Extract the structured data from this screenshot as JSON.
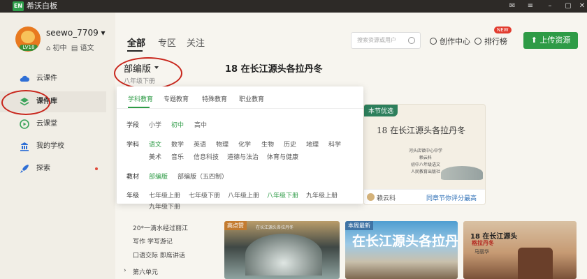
{
  "app": {
    "logo": "EN",
    "title": "希沃白板"
  },
  "user": {
    "name": "seewo_7709",
    "school_level": "初中",
    "subject": "语文",
    "level_badge": "LV18"
  },
  "sidebar": {
    "items": [
      {
        "label": "云课件",
        "icon": "cloud-icon"
      },
      {
        "label": "课件库",
        "icon": "library-icon"
      },
      {
        "label": "云课堂",
        "icon": "play-icon"
      },
      {
        "label": "我的学校",
        "icon": "school-icon"
      },
      {
        "label": "探索",
        "icon": "rocket-icon"
      }
    ]
  },
  "tabs": [
    "全部",
    "专区",
    "关注"
  ],
  "search": {
    "placeholder": "搜索资源或用户"
  },
  "header": {
    "creator_center": "创作中心",
    "ranking": "排行榜",
    "new_badge": "NEW",
    "upload": "上传资源"
  },
  "toc": {
    "edition": "部编版",
    "grade": "八年级下册",
    "items": [
      "20*一滴水经过丽江",
      "写作 学写游记",
      "口语交际 即席讲话",
      "第六单元"
    ]
  },
  "lesson_title": "18 在长江源头各拉丹冬",
  "featured": {
    "badge": "本节优选",
    "title": "18 在长江源头各拉丹冬",
    "lines": [
      "河头店镇中心中学",
      "赖云科",
      "初中八年级语文",
      "人民教育出版社"
    ],
    "author": "赖云科",
    "award": "同章节你评分最高"
  },
  "cards": [
    {
      "label": "高点赞",
      "title": "在长江源头各拉丹冬"
    },
    {
      "label": "本周最新",
      "title": "在长江源头各拉丹冬"
    },
    {
      "label": "",
      "title": "18 在长江源头",
      "subtitle": "格拉丹冬",
      "author": "马丽华"
    }
  ],
  "filter": {
    "tabs": [
      "学科教育",
      "专题教育",
      "特殊教育",
      "职业教育"
    ],
    "rows": {
      "stage": {
        "label": "学段",
        "options": [
          "小学",
          "初中",
          "高中"
        ]
      },
      "subject": {
        "label": "学科",
        "options": [
          "语文",
          "数学",
          "英语",
          "物理",
          "化学",
          "生物",
          "历史",
          "地理",
          "科学",
          "美术",
          "音乐",
          "信息科技",
          "道德与法治",
          "体育与健康"
        ]
      },
      "textbook": {
        "label": "教材",
        "options": [
          "部编版",
          "部编版（五四制）"
        ]
      },
      "grade": {
        "label": "年级",
        "options": [
          "七年级上册",
          "七年级下册",
          "八年级上册",
          "八年级下册",
          "九年级上册",
          "九年级下册"
        ]
      }
    }
  },
  "colors": {
    "accent": "#2e9b46",
    "annotation": "#c8251b"
  }
}
